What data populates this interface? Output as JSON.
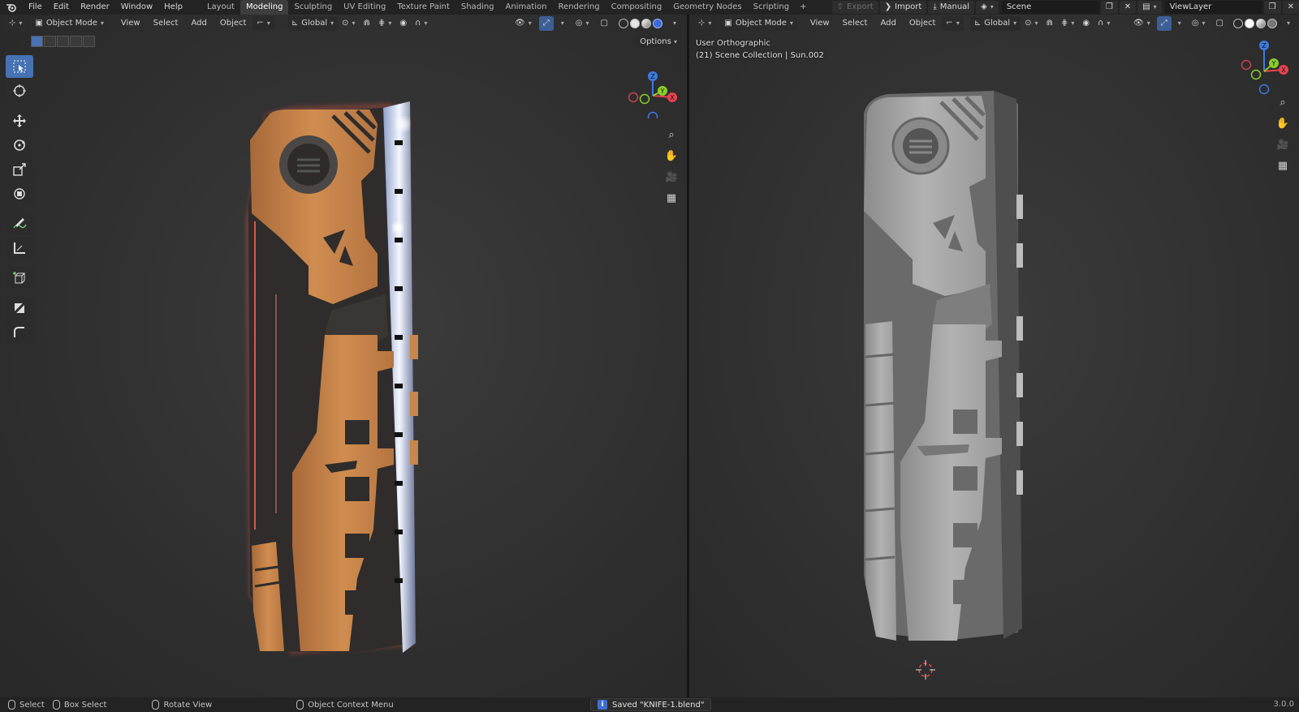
{
  "menubar": {
    "items": [
      "File",
      "Edit",
      "Render",
      "Window",
      "Help"
    ]
  },
  "workspaces": {
    "tabs": [
      "Layout",
      "Modeling",
      "Sculpting",
      "UV Editing",
      "Texture Paint",
      "Shading",
      "Animation",
      "Rendering",
      "Compositing",
      "Geometry Nodes",
      "Scripting"
    ],
    "active": "Modeling",
    "add_symbol": "+"
  },
  "topright": {
    "export_label": "Export",
    "import_label": "Import",
    "manual_label": "Manual",
    "scene_name": "Scene",
    "view_layer_name": "ViewLayer"
  },
  "viewport_header": {
    "mode": "Object Mode",
    "menus": [
      "View",
      "Select",
      "Add",
      "Object"
    ],
    "transform_orientation": "Global"
  },
  "left_viewport": {
    "options_label": "Options"
  },
  "right_viewport": {
    "view_name": "User Orthographic",
    "collection_info": "(21) Scene Collection | Sun.002"
  },
  "gizmo": {
    "x": "X",
    "y": "Y",
    "z": "Z"
  },
  "statusbar": {
    "select": "Select",
    "box_select": "Box Select",
    "rotate_view": "Rotate View",
    "context_menu": "Object Context Menu",
    "message": "Saved \"KNIFE-1.blend\"",
    "version": "3.0.0"
  },
  "colors": {
    "accent": "#4772b3",
    "orange_panel": "#c8874c",
    "axis_x": "#e8434e",
    "axis_y": "#8acc2a",
    "axis_z": "#3d7ae0"
  }
}
